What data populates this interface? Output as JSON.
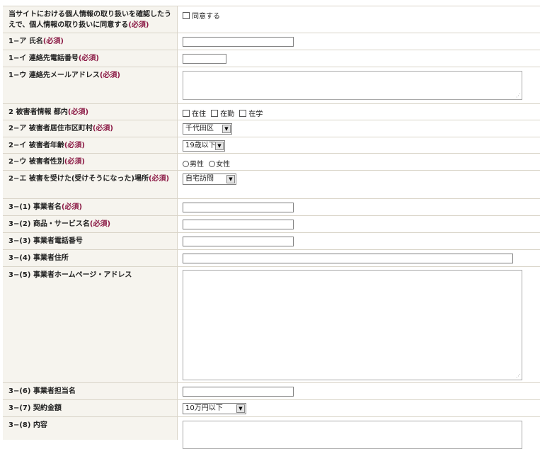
{
  "required_mark": "(必須)",
  "rows": {
    "consent": {
      "label": "当サイトにおける個人情報の取り扱いを確認したうえで、個人情報の取り扱いに同意する",
      "option": "同意する"
    },
    "name": {
      "label": "1−ア 氏名",
      "value": ""
    },
    "phone": {
      "label": "1−イ 連絡先電話番号",
      "value": ""
    },
    "email": {
      "label": "1−ウ 連絡先メールアドレス",
      "value": ""
    },
    "victim_info": {
      "label": "2 被害者情報 都内",
      "options": [
        "在住",
        "在勤",
        "在学"
      ]
    },
    "residence": {
      "label": "2−ア 被害者居住市区町村",
      "selected": "千代田区"
    },
    "age": {
      "label": "2−イ 被害者年齢",
      "selected": "19歳以下"
    },
    "gender": {
      "label": "2−ウ 被害者性別",
      "options": [
        "男性",
        "女性"
      ]
    },
    "place": {
      "label": "2−エ 被害を受けた(受けそうになった)場所",
      "selected": "自宅訪問"
    },
    "biz_name": {
      "label": "3−(1) 事業者名",
      "value": ""
    },
    "product": {
      "label": "3−(2) 商品・サービス名",
      "value": ""
    },
    "biz_phone": {
      "label": "3−(3) 事業者電話番号",
      "value": ""
    },
    "biz_address": {
      "label": "3−(4) 事業者住所",
      "value": ""
    },
    "biz_homepage": {
      "label": "3−(5) 事業者ホームページ・アドレス",
      "value": ""
    },
    "biz_contact": {
      "label": "3−(6) 事業者担当名",
      "value": ""
    },
    "amount": {
      "label": "3−(7) 契約金額",
      "selected": "10万円以下"
    },
    "content": {
      "label": "3−(8) 内容",
      "value": ""
    }
  },
  "icons": {
    "dropdown_arrow": "▼",
    "resize_grip": "⋰"
  }
}
